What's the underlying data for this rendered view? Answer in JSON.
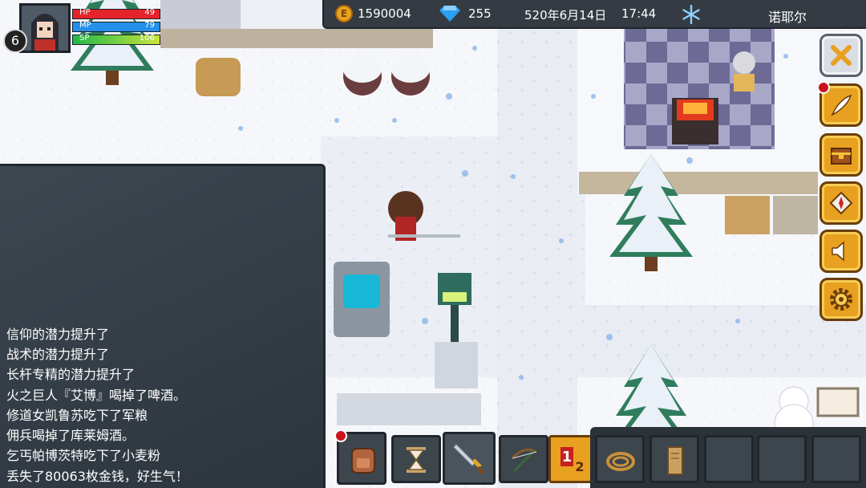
{
  "status": {
    "gold": "1590004",
    "gems": "255",
    "date": "520年6月14日",
    "time": "17:44",
    "weather_icon": "snowflake-icon",
    "location": "诺耶尔"
  },
  "player": {
    "level": "6",
    "hp_label": "HP",
    "hp": "49",
    "hp_fill": 1.0,
    "mp_label": "MP",
    "mp": "79",
    "mp_fill": 1.0,
    "sp_label": "SP",
    "sp": "106",
    "sp_fill": 1.0
  },
  "log": {
    "lines": [
      "信仰的潜力提升了",
      "战术的潜力提升了",
      "长杆专精的潜力提升了",
      "火之巨人『艾博』喝掉了啤酒。",
      "修道女凯鲁苏吃下了军粮",
      "佣兵喝掉了库莱姆酒。",
      "乞丐帕博茨特吃下了小麦粉",
      "丢失了80063枚金钱，好生气！"
    ]
  },
  "menu": {
    "icons": [
      "close-x-icon",
      "quill-icon",
      "treasure-chest-icon",
      "map-icon",
      "speaker-icon",
      "gear-icon"
    ]
  },
  "hotbar": {
    "slots": [
      "backpack-icon",
      "hourglass-icon",
      "sword-icon",
      "crossbow-icon",
      "weapon-set-toggle-icon",
      "rope-icon",
      "scroll-icon",
      "",
      "",
      ""
    ],
    "toggle_text": "1 2"
  },
  "colors": {
    "hp": "#e5232b",
    "mp": "#2590e8",
    "sp": "#20b84a",
    "menu_button": "#e8a020",
    "panel": "#343b42"
  }
}
